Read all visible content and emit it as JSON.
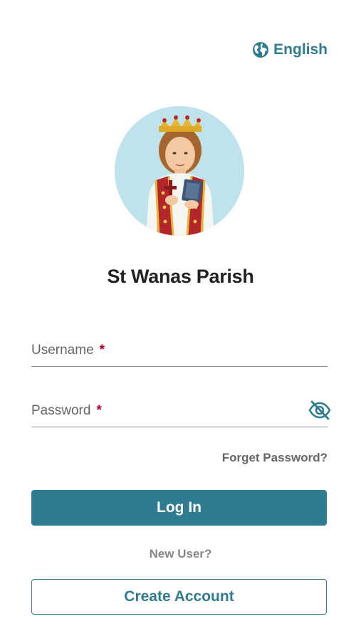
{
  "header": {
    "language_label": "English",
    "language_icon": "globe-icon"
  },
  "profile": {
    "avatar_icon": "saint-portrait",
    "parish_name": "St Wanas Parish"
  },
  "form": {
    "username": {
      "label": "Username",
      "required_mark": "*",
      "value": ""
    },
    "password": {
      "label": "Password",
      "required_mark": "*",
      "value": "",
      "visibility_icon": "eye-off-icon"
    },
    "forget_password_label": "Forget Password?",
    "login_label": "Log In",
    "new_user_label": "New User?",
    "create_account_label": "Create Account"
  },
  "colors": {
    "accent": "#2f7c92",
    "required": "#b00020",
    "text_muted": "#666666",
    "title": "#222222"
  }
}
